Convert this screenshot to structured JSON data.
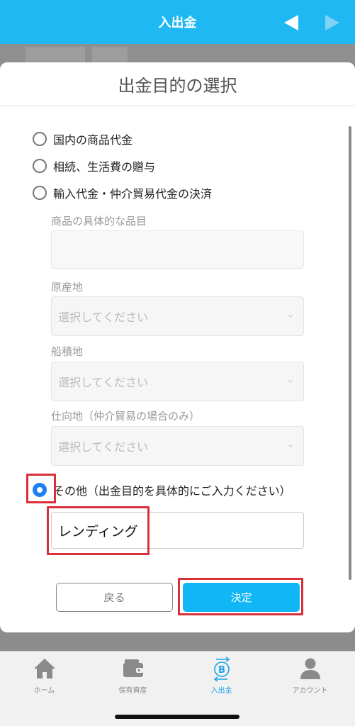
{
  "header": {
    "title": "入出金",
    "prev_icon": "triangle-left-icon",
    "next_icon": "triangle-right-icon"
  },
  "modal": {
    "title": "出金目的の選択",
    "options": [
      {
        "label": "国内の商品代金",
        "checked": false
      },
      {
        "label": "相続、生活費の贈与",
        "checked": false
      },
      {
        "label": "輸入代金・仲介貿易代金の決済",
        "checked": false
      },
      {
        "label": "その他（出金目的を具体的にご入力ください）",
        "checked": true
      }
    ],
    "fields": {
      "item_label": "商品の具体的な品目",
      "item_value": "",
      "origin_label": "原産地",
      "origin_placeholder": "選択してください",
      "loading_label": "船積地",
      "loading_placeholder": "選択してください",
      "destination_label": "仕向地（仲介貿易の場合のみ）",
      "destination_placeholder": "選択してください"
    },
    "other_value": "レンディング",
    "back_label": "戻る",
    "confirm_label": "決定"
  },
  "tabs": [
    {
      "label": "ホーム",
      "icon": "home-icon",
      "active": false
    },
    {
      "label": "保有資産",
      "icon": "wallet-icon",
      "active": false
    },
    {
      "label": "入出金",
      "icon": "bitcoin-transfer-icon",
      "active": true
    },
    {
      "label": "アカウント",
      "icon": "person-icon",
      "active": false
    }
  ],
  "colors": {
    "brand": "#1fb8f3",
    "radio_selected": "#1e7ff0",
    "highlight": "#d9303a",
    "active_tab": "#1ea6e6"
  }
}
